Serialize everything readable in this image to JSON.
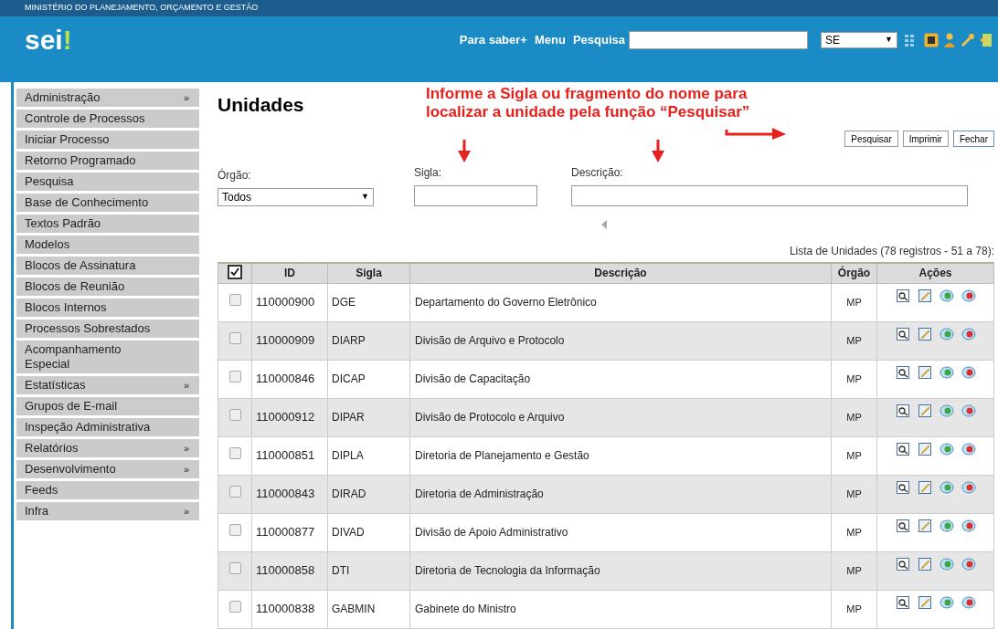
{
  "header": {
    "ministry": "MINISTÉRIO DO PLANEJAMENTO, ORÇAMENTO E GESTÃO",
    "logo": "sei",
    "logo_mark": "!",
    "links": [
      "Para saber+",
      "Menu"
    ],
    "search_label": "Pesquisa",
    "unit_select": "SE",
    "unit_caret": "▼"
  },
  "sidebar": {
    "items": [
      {
        "label": "Administração",
        "arrow": "»"
      },
      {
        "label": "Controle de Processos"
      },
      {
        "label": "Iniciar Processo"
      },
      {
        "label": "Retorno Programado"
      },
      {
        "label": "Pesquisa"
      },
      {
        "label": "Base de Conhecimento"
      },
      {
        "label": "Textos Padrão"
      },
      {
        "label": "Modelos"
      },
      {
        "label": "Blocos de Assinatura"
      },
      {
        "label": "Blocos de Reunião"
      },
      {
        "label": "Blocos Internos"
      },
      {
        "label": "Processos Sobrestados"
      },
      {
        "label": "Acompanhamento Especial"
      },
      {
        "label": "Estatísticas",
        "arrow": "»"
      },
      {
        "label": "Grupos de E-mail"
      },
      {
        "label": "Inspeção Administrativa"
      },
      {
        "label": "Relatórios",
        "arrow": "»"
      },
      {
        "label": "Desenvolvimento",
        "arrow": "»"
      },
      {
        "label": "Feeds"
      },
      {
        "label": "Infra",
        "arrow": "»"
      }
    ]
  },
  "page": {
    "title": "Unidades",
    "annotation": [
      "Informe a Sigla ou fragmento do nome para",
      "localizar a unidade pela função “Pesquisar”"
    ],
    "buttons": [
      "Pesquisar",
      "Imprimir",
      "Fechar"
    ],
    "filters": {
      "orgao_label": "Órgão:",
      "orgao_value": "Todos",
      "orgao_caret": "▼",
      "sigla_label": "Sigla:",
      "descricao_label": "Descrição:"
    },
    "caption": "Lista de Unidades (78 registros - 51 a 78):"
  },
  "table": {
    "select_all_checked": true,
    "columns": [
      "ID",
      "Sigla",
      "Descrição",
      "Órgão",
      "Ações"
    ],
    "rows": [
      {
        "checked": false,
        "id": "110000900",
        "sigla": "DGE",
        "descricao": "Departamento do Governo Eletrônico",
        "orgao": "MP"
      },
      {
        "checked": false,
        "id": "110000909",
        "sigla": "DIARP",
        "descricao": "Divisão de Arquivo e Protocolo",
        "orgao": "MP"
      },
      {
        "checked": false,
        "id": "110000846",
        "sigla": "DICAP",
        "descricao": "Divisão de Capacitação",
        "orgao": "MP"
      },
      {
        "checked": false,
        "id": "110000912",
        "sigla": "DIPAR",
        "descricao": "Divisão de Protocolo e Arquivo",
        "orgao": "MP"
      },
      {
        "checked": false,
        "id": "110000851",
        "sigla": "DIPLA",
        "descricao": "Diretoria de Planejamento e Gestão",
        "orgao": "MP"
      },
      {
        "checked": false,
        "id": "110000843",
        "sigla": "DIRAD",
        "descricao": "Diretoria de Administração",
        "orgao": "MP"
      },
      {
        "checked": false,
        "id": "110000877",
        "sigla": "DIVAD",
        "descricao": "Divisão de Apoio Administrativo",
        "orgao": "MP"
      },
      {
        "checked": false,
        "id": "110000858",
        "sigla": "DTI",
        "descricao": "Diretoria de Tecnologia da Informação",
        "orgao": "MP"
      },
      {
        "checked": false,
        "id": "110000838",
        "sigla": "GABMIN",
        "descricao": "Gabinete do Ministro",
        "orgao": "MP"
      }
    ]
  }
}
